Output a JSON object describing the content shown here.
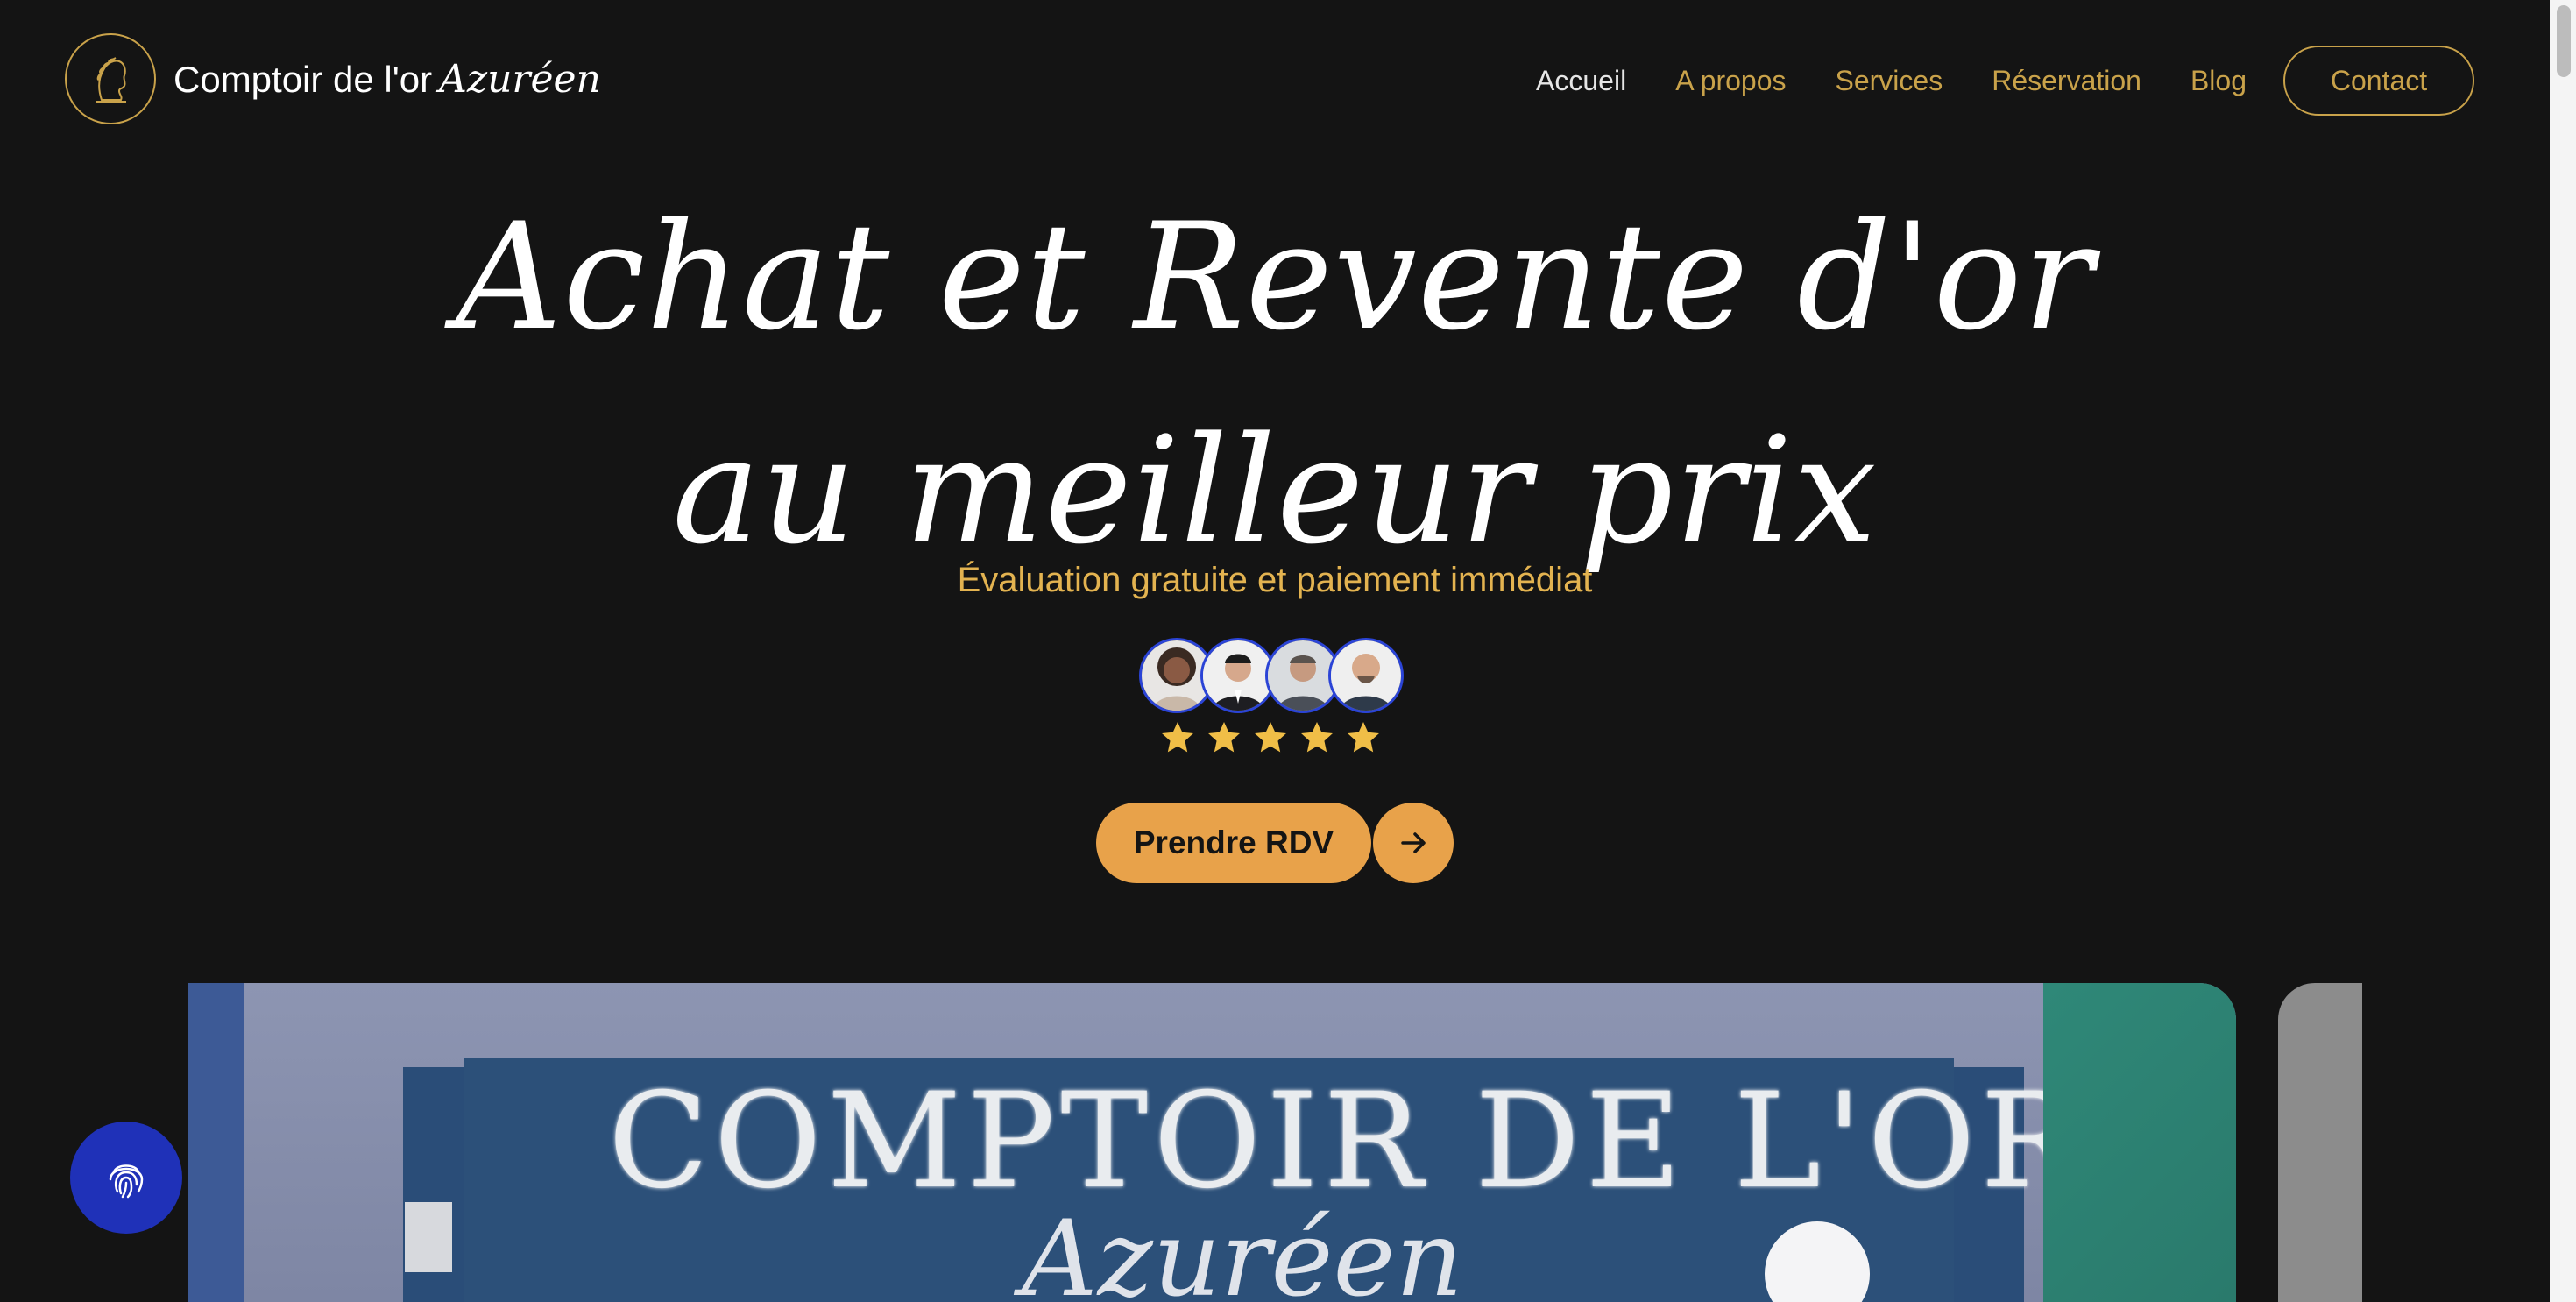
{
  "brand": {
    "name": "Comptoir de l'or",
    "script": "Azuréen"
  },
  "nav": {
    "items": [
      {
        "label": "Accueil",
        "active": true
      },
      {
        "label": "A propos"
      },
      {
        "label": "Services"
      },
      {
        "label": "Réservation"
      },
      {
        "label": "Blog"
      }
    ],
    "contact_label": "Contact"
  },
  "hero": {
    "title_line1": "Achat et Revente d'or",
    "title_line2": "au meilleur prix",
    "subtitle": "Évaluation gratuite et paiement immédiat",
    "rating": 5,
    "rating_max": 5,
    "cta_label": "Prendre RDV"
  },
  "storefront": {
    "sign_text": "COMPTOIR DE L'OR",
    "sign_script": "Azuréen"
  },
  "colors": {
    "background": "#141414",
    "gold": "#c9a24a",
    "subtitle_gold": "#e3b350",
    "cta_orange": "#e8a24a",
    "star_yellow": "#f0be47",
    "accessibility_blue": "#1f31b8",
    "avatar_border": "#2b44d6"
  },
  "icons": {
    "logo": "laurel-profile-icon",
    "cta_arrow": "arrow-right-icon",
    "accessibility": "fingerprint-icon",
    "rating": "star-icon"
  }
}
